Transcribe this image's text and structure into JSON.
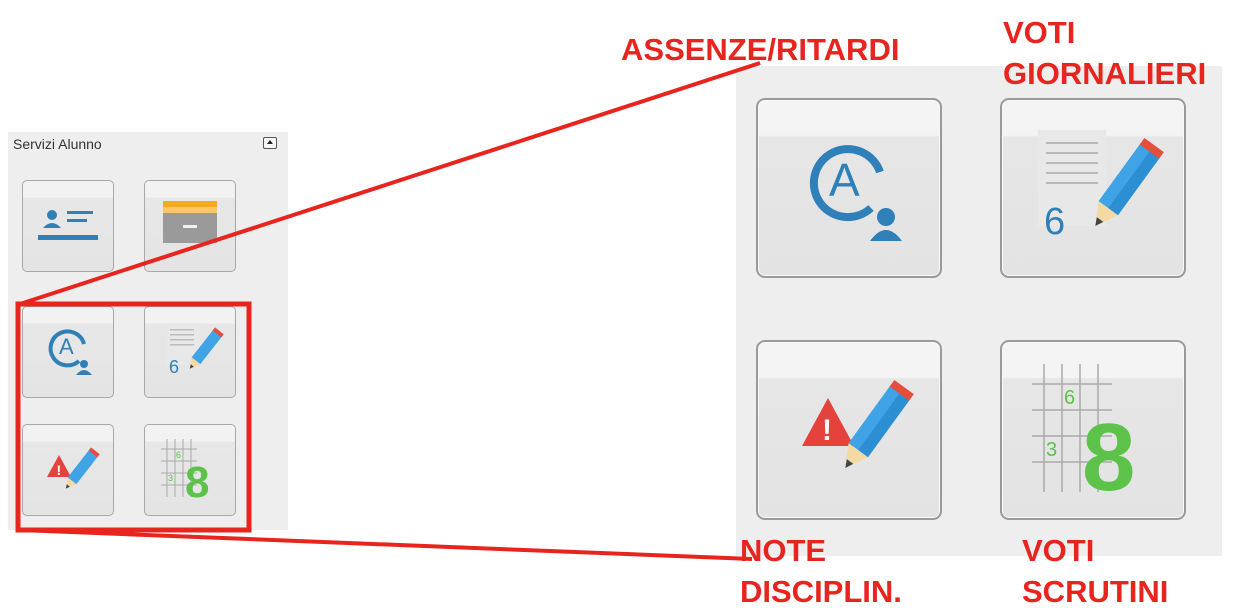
{
  "panel": {
    "title": "Servizi Alunno"
  },
  "tiles": {
    "anagrafica": {
      "icon": "student-card-icon"
    },
    "archivio": {
      "icon": "archive-drawer-icon"
    },
    "assenze": {
      "icon": "absence-a-user-icon",
      "letter": "A"
    },
    "voti_giornalieri": {
      "icon": "document-grade-pencil-icon",
      "number": "6"
    },
    "note": {
      "icon": "warning-pencil-icon",
      "mark": "!"
    },
    "voti_scrutini": {
      "icon": "grade-grid-icon",
      "small_top": "6",
      "small_bottom": "3",
      "big": "8"
    }
  },
  "callouts": {
    "assenze": "ASSENZE/RITARDI",
    "voti_giornalieri_line1": "VOTI",
    "voti_giornalieri_line2": "GIORNALIERI",
    "note_line1": "NOTE",
    "note_line2": "DISCIPLIN.",
    "voti_scrutini_line1": "VOTI",
    "voti_scrutini_line2": "SCRUTINI"
  },
  "colors": {
    "annotation_red": "#e8241f",
    "icon_blue": "#2f7fb8",
    "pencil_blue": "#3fa3e6",
    "warning_red": "#e3433c",
    "grade_green": "#5cc24a",
    "folder_orange": "#f4a922"
  }
}
